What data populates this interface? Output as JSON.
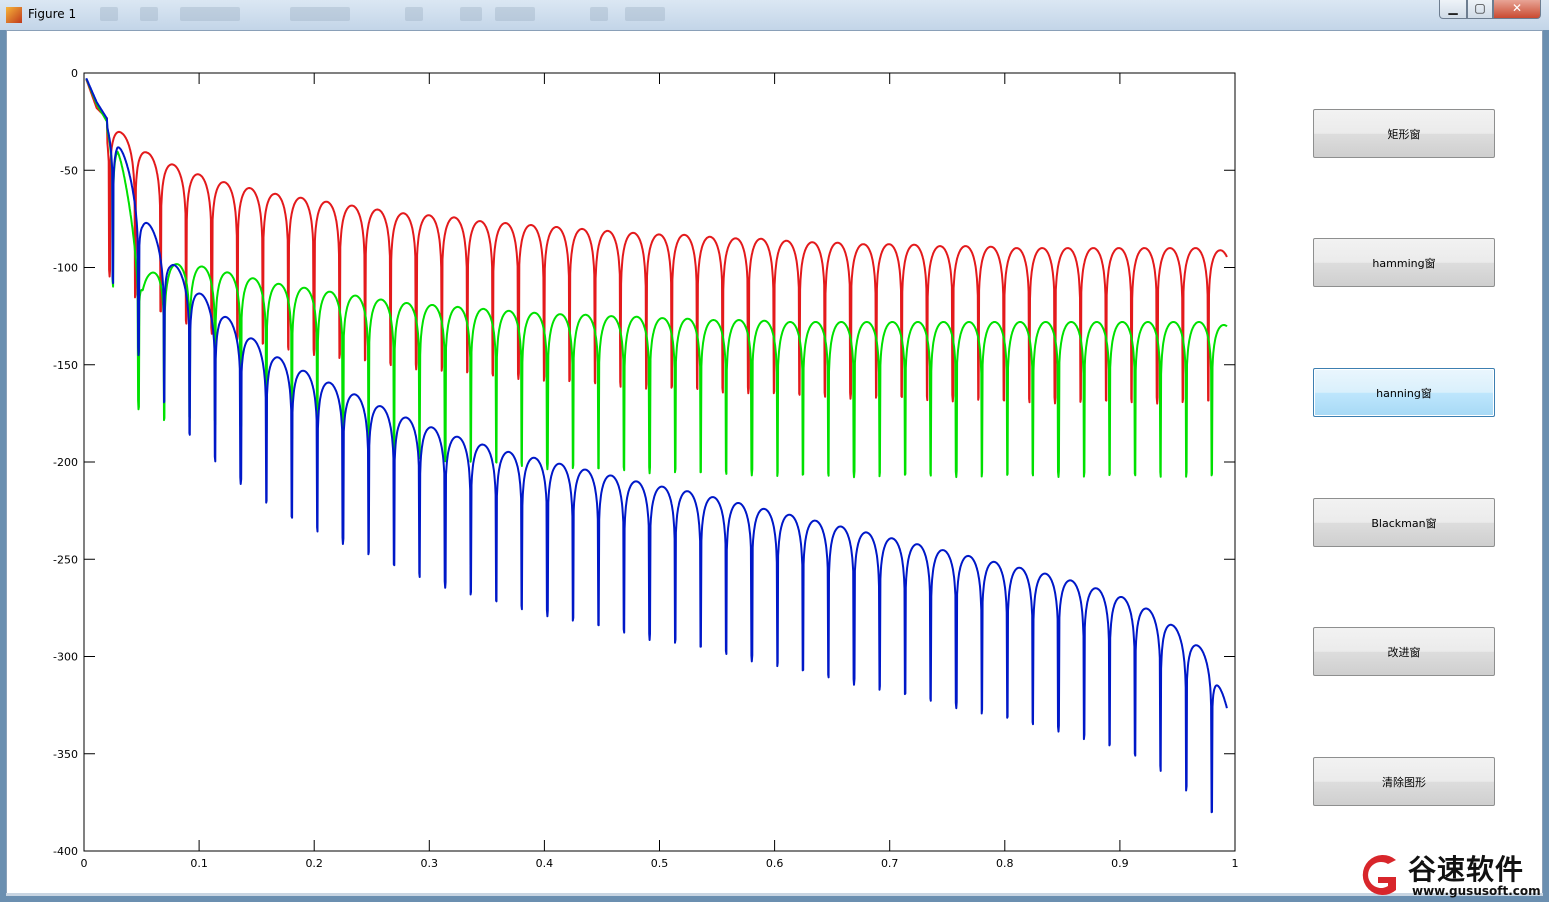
{
  "window": {
    "title": "Figure 1",
    "min_glyph": "▁",
    "max_glyph": "▢",
    "close_glyph": "✕"
  },
  "buttons": [
    {
      "label": "矩形窗",
      "active": false
    },
    {
      "label": "hamming窗",
      "active": false
    },
    {
      "label": "hanning窗",
      "active": true
    },
    {
      "label": "Blackman窗",
      "active": false
    },
    {
      "label": "改进窗",
      "active": false
    },
    {
      "label": "清除图形",
      "active": false
    }
  ],
  "watermark": {
    "name": "谷速软件",
    "url": "www.gususoft.com",
    "logo_color": "#d8262b"
  },
  "chart_data": {
    "type": "line",
    "title": "",
    "xlabel": "",
    "ylabel": "",
    "xlim": [
      0,
      1
    ],
    "ylim": [
      -400,
      0
    ],
    "xticks": [
      0,
      0.1,
      0.2,
      0.3,
      0.4,
      0.5,
      0.6,
      0.7,
      0.8,
      0.9,
      1
    ],
    "yticks": [
      0,
      -50,
      -100,
      -150,
      -200,
      -250,
      -300,
      -350,
      -400
    ],
    "xtick_labels": [
      "0",
      "0.1",
      "0.2",
      "0.3",
      "0.4",
      "0.5",
      "0.6",
      "0.7",
      "0.8",
      "0.9",
      "1"
    ],
    "ytick_labels": [
      "0",
      "-50",
      "-100",
      "-150",
      "-200",
      "-250",
      "-300",
      "-350",
      "-400"
    ],
    "grid": false,
    "legend": "none",
    "series": [
      {
        "color": "#e31a1c",
        "description": "red sidelobe curve; lobe peaks approx",
        "x": [
          0,
          0.011,
          0.033,
          0.055,
          0.077,
          0.099,
          0.121,
          0.143,
          0.165,
          0.187,
          0.209,
          0.231,
          0.253,
          0.275,
          0.297,
          0.319,
          0.341,
          0.363,
          0.385,
          0.407,
          0.429,
          0.451,
          0.473,
          0.495,
          0.517,
          0.539,
          0.561,
          0.583,
          0.605,
          0.627,
          0.649,
          0.671,
          0.693,
          0.715,
          0.737,
          0.759,
          0.781,
          0.803,
          0.825,
          0.847,
          0.869,
          0.891,
          0.913,
          0.935,
          0.957,
          0.979,
          0.994
        ],
        "y": [
          0,
          -18,
          -31,
          -41,
          -47,
          -52,
          -56,
          -59,
          -62,
          -64,
          -66,
          -68,
          -70,
          -72,
          -73,
          -74,
          -76,
          -77,
          -78,
          -79,
          -80,
          -81,
          -82,
          -83,
          -83,
          -84,
          -85,
          -85,
          -86,
          -87,
          -87,
          -88,
          -88,
          -88,
          -89,
          -89,
          -89,
          -90,
          -90,
          -90,
          -90,
          -90,
          -90,
          -90,
          -90,
          -90,
          -92
        ]
      },
      {
        "color": "#00e000",
        "description": "green sidelobe curve; lobe peaks approx",
        "x": [
          0,
          0.011,
          0.029,
          0.051,
          0.075,
          0.099,
          0.121,
          0.143,
          0.165,
          0.187,
          0.209,
          0.231,
          0.253,
          0.275,
          0.297,
          0.319,
          0.341,
          0.363,
          0.385,
          0.407,
          0.429,
          0.451,
          0.473,
          0.495,
          0.517,
          0.539,
          0.561,
          0.583,
          0.605,
          0.627,
          0.649,
          0.671,
          0.693,
          0.715,
          0.737,
          0.759,
          0.781,
          0.803,
          0.825,
          0.847,
          0.869,
          0.891,
          0.913,
          0.935,
          0.957,
          0.979,
          0.994
        ],
        "y": [
          0,
          -16,
          -34,
          -105,
          -98,
          -99,
          -102,
          -105,
          -108,
          -110,
          -112,
          -114,
          -116,
          -118,
          -119,
          -120,
          -121,
          -122,
          -123,
          -124,
          -124,
          -125,
          -125,
          -126,
          -126,
          -127,
          -127,
          -127,
          -128,
          -128,
          -128,
          -128,
          -128,
          -128,
          -128,
          -128,
          -128,
          -128,
          -128,
          -128,
          -128,
          -128,
          -128,
          -128,
          -128,
          -128,
          -130
        ]
      },
      {
        "color": "#0018c8",
        "description": "blue sidelobe curve; lobe peaks approx",
        "x": [
          0,
          0.011,
          0.029,
          0.051,
          0.075,
          0.099,
          0.121,
          0.143,
          0.165,
          0.187,
          0.209,
          0.231,
          0.253,
          0.275,
          0.297,
          0.319,
          0.341,
          0.363,
          0.385,
          0.407,
          0.429,
          0.451,
          0.473,
          0.495,
          0.517,
          0.539,
          0.561,
          0.583,
          0.605,
          0.627,
          0.649,
          0.671,
          0.693,
          0.715,
          0.737,
          0.759,
          0.781,
          0.803,
          0.825,
          0.847,
          0.869,
          0.891,
          0.913,
          0.935,
          0.957,
          0.979,
          0.994
        ],
        "y": [
          0,
          -15,
          -32,
          -72,
          -96,
          -112,
          -124,
          -135,
          -145,
          -152,
          -158,
          -164,
          -170,
          -176,
          -181,
          -186,
          -190,
          -194,
          -197,
          -200,
          -203,
          -206,
          -209,
          -212,
          -214,
          -217,
          -220,
          -223,
          -226,
          -229,
          -232,
          -235,
          -238,
          -241,
          -244,
          -247,
          -250,
          -253,
          -256,
          -259,
          -263,
          -267,
          -272,
          -279,
          -289,
          -300,
          -328
        ]
      }
    ]
  }
}
